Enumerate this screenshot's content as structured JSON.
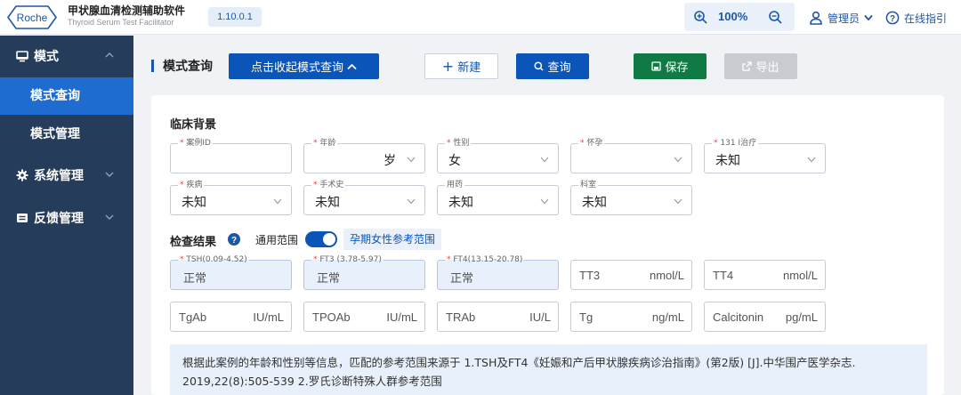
{
  "header": {
    "logo_text": "Roche",
    "app_title": "甲状腺血清检测辅助软件",
    "app_subtitle": "Thyroid Serum Test Facilitator",
    "version": "1.10.0.1",
    "zoom_level": "100%",
    "user_label": "管理员",
    "help_label": "在线指引"
  },
  "sidebar": {
    "groups": [
      {
        "label": "模式",
        "icon": "monitor-icon",
        "expanded": true
      },
      {
        "label": "系统管理",
        "icon": "gear-icon",
        "expanded": false
      },
      {
        "label": "反馈管理",
        "icon": "feedback-icon",
        "expanded": false
      }
    ],
    "items": [
      {
        "label": "模式查询",
        "active": true
      },
      {
        "label": "模式管理",
        "active": false
      }
    ]
  },
  "toolbar": {
    "title": "模式查询",
    "toggle_label": "点击收起模式查询",
    "new_label": "新建",
    "query_label": "查询",
    "save_label": "保存",
    "export_label": "导出"
  },
  "clinical": {
    "title": "临床背景",
    "fields": [
      {
        "label": "案例ID",
        "required": true,
        "value": ""
      },
      {
        "label": "年龄",
        "required": true,
        "value": "",
        "unit": "岁"
      },
      {
        "label": "性别",
        "required": true,
        "value": "女"
      },
      {
        "label": "怀孕",
        "required": true,
        "value": ""
      },
      {
        "label": "131 I治疗",
        "required": true,
        "value": "未知"
      },
      {
        "label": "疾病",
        "required": true,
        "value": "未知"
      },
      {
        "label": "手术史",
        "required": true,
        "value": "未知"
      },
      {
        "label": "用药",
        "required": false,
        "value": "未知"
      },
      {
        "label": "科室",
        "required": false,
        "value": "未知"
      }
    ]
  },
  "results": {
    "title": "检查结果",
    "range_general": "通用范围",
    "range_pregnant": "孕期女性参考范围",
    "toggle_on": true,
    "blue_fields": [
      {
        "label": "TSH(0.09-4.52)",
        "value": "正常"
      },
      {
        "label": "FT3 (3.78-5.97)",
        "value": "正常"
      },
      {
        "label": "FT4(13.15-20.78)",
        "value": "正常"
      }
    ],
    "unit_fields_row1": [
      {
        "name": "TT3",
        "unit": "nmol/L"
      },
      {
        "name": "TT4",
        "unit": "nmol/L"
      }
    ],
    "unit_fields_row2": [
      {
        "name": "TgAb",
        "unit": "IU/mL"
      },
      {
        "name": "TPOAb",
        "unit": "IU/mL"
      },
      {
        "name": "TRAb",
        "unit": "IU/L"
      },
      {
        "name": "Tg",
        "unit": "ng/mL"
      },
      {
        "name": "Calcitonin",
        "unit": "pg/mL"
      }
    ]
  },
  "tip": {
    "text": "根据此案例的年龄和性别等信息，匹配的参考范围来源于 1.TSH及FT4《妊娠和产后甲状腺疾病诊治指南》(第2版) [J].中华围产医学杂志. 2019,22(8):505-539 2.罗氏诊断特殊人群参考范围"
  },
  "colors": {
    "primary": "#0b55b8",
    "sidebar": "#253c5a",
    "active": "#1f6cd1",
    "save": "#0f7a43",
    "disabled": "#c8cbcf",
    "required": "#e53e3e"
  }
}
